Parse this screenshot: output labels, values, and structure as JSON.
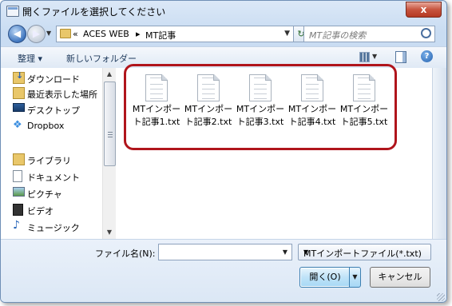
{
  "window": {
    "title": "開くファイルを選択してください",
    "close_glyph": "x"
  },
  "nav": {
    "back_glyph": "◀",
    "forward_glyph": "▶",
    "breadcrumb_sep": "«",
    "breadcrumb": [
      "ACES WEB",
      "MT記事"
    ],
    "arrow": "▸",
    "search_placeholder": "MT記事の検索"
  },
  "toolbar": {
    "organize": "整理 ▾",
    "new_folder": "新しいフォルダー",
    "help": "?"
  },
  "sidebar": {
    "items": [
      {
        "label": "ダウンロード",
        "icon": "download-icon"
      },
      {
        "label": "最近表示した場所",
        "icon": "recent-places-icon"
      },
      {
        "label": "デスクトップ",
        "icon": "desktop-icon"
      },
      {
        "label": "Dropbox",
        "icon": "dropbox-icon"
      },
      {
        "label": "ライブラリ",
        "icon": "library-icon"
      },
      {
        "label": "ドキュメント",
        "icon": "document-icon"
      },
      {
        "label": "ピクチャ",
        "icon": "picture-icon"
      },
      {
        "label": "ビデオ",
        "icon": "video-icon"
      },
      {
        "label": "ミュージック",
        "icon": "music-icon"
      }
    ]
  },
  "files": [
    {
      "name": "MTインポート記事1.txt"
    },
    {
      "name": "MTインポート記事2.txt"
    },
    {
      "name": "MTインポート記事3.txt"
    },
    {
      "name": "MTインポート記事4.txt"
    },
    {
      "name": "MTインポート記事5.txt"
    }
  ],
  "bottom": {
    "filename_label": "ファイル名(N):",
    "filename_value": "",
    "filter_value": "MTインポートファイル(*.txt)",
    "open_label": "開く(O)",
    "cancel_label": "キャンセル"
  },
  "colors": {
    "highlight": "#b0151c",
    "accent": "#3c7fb1"
  }
}
